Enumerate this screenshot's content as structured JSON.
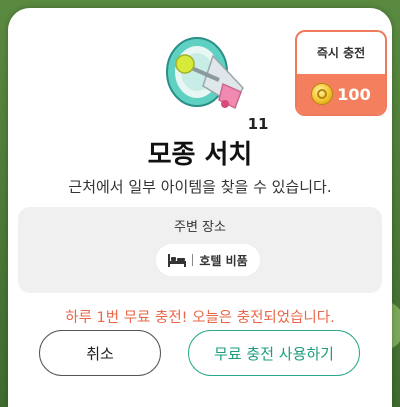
{
  "dialog": {
    "item_count": "11",
    "title": "모종 서치",
    "description": "근처에서 일부 아이템을 찾을 수 있습니다."
  },
  "instant_charge": {
    "label": "즉시 충전",
    "price": "100",
    "icon": "coin-icon"
  },
  "nearby": {
    "heading": "주변 장소",
    "place_label": "호텔 비품",
    "place_icon": "bed-icon"
  },
  "notice": "하루 1번 무료 충전! 오늘은 충전되었습니다.",
  "buttons": {
    "cancel": "취소",
    "use_free_charge": "무료 충전 사용하기"
  },
  "colors": {
    "accent_orange": "#f47f5f",
    "accent_teal": "#2aa98b",
    "notice_text": "#e9684a"
  }
}
